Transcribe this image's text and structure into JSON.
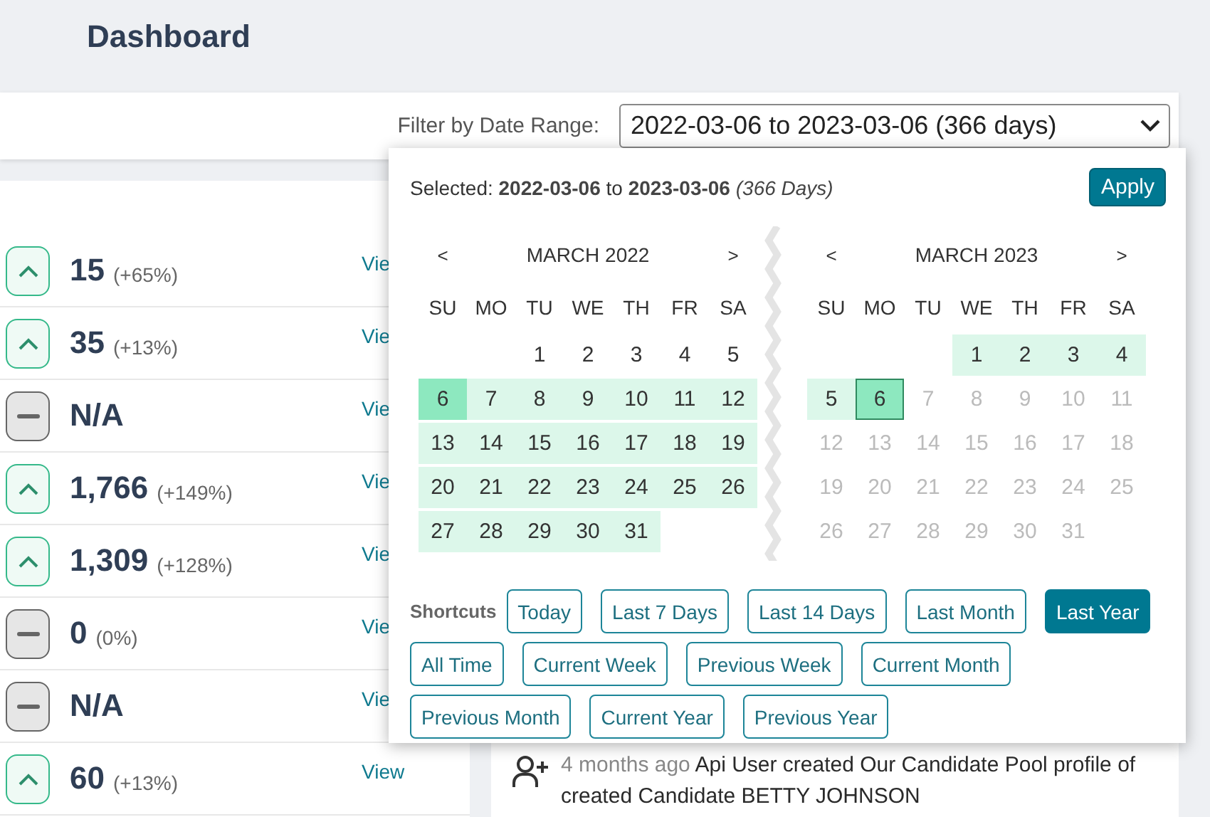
{
  "page": {
    "title": "Dashboard"
  },
  "filter": {
    "label": "Filter by Date Range:",
    "value": "2022-03-06 to 2023-03-06 (366 days)"
  },
  "stats": [
    {
      "kind": "up",
      "value": "15",
      "change": "(+65%)",
      "link": "Vie"
    },
    {
      "kind": "up",
      "value": "35",
      "change": "(+13%)",
      "link": "Vie"
    },
    {
      "kind": "flat",
      "value": "N/A",
      "link": "Vie"
    },
    {
      "kind": "up",
      "value": "1,766",
      "change": "(+149%)",
      "link": "Vie"
    },
    {
      "kind": "up",
      "value": "1,309",
      "change": "(+128%)",
      "link": "Vie"
    },
    {
      "kind": "flat",
      "value": "0",
      "change": "(0%)",
      "link": "Vie"
    },
    {
      "kind": "flat",
      "value": "N/A",
      "link": "Vie"
    },
    {
      "kind": "up",
      "value": "60",
      "change": "(+13%)",
      "link": "View"
    }
  ],
  "activity": {
    "time": "4 months ago",
    "text": "Api User created Our Candidate Pool profile of created Candidate BETTY JOHNSON"
  },
  "picker": {
    "summary": "Selected: **2022-03-06** to **2023-03-06** *(366 Days)*",
    "apply": "Apply",
    "months": [
      {
        "title": "MARCH 2022",
        "prev": "<",
        "next": ">",
        "weekdays": [
          "SU",
          "MO",
          "TU",
          "WE",
          "TH",
          "FR",
          "SA"
        ],
        "weeks": [
          [
            {
              "kind": "blank"
            },
            {
              "kind": "blank"
            },
            {
              "kind": "day",
              "day": "1",
              "in_range": false,
              "endpoint": false,
              "focused": false,
              "disabled": false
            },
            {
              "kind": "day",
              "day": "2",
              "in_range": false,
              "endpoint": false,
              "focused": false,
              "disabled": false
            },
            {
              "kind": "day",
              "day": "3",
              "in_range": false,
              "endpoint": false,
              "focused": false,
              "disabled": false
            },
            {
              "kind": "day",
              "day": "4",
              "in_range": false,
              "endpoint": false,
              "focused": false,
              "disabled": false
            },
            {
              "kind": "day",
              "day": "5",
              "in_range": false,
              "endpoint": false,
              "focused": false,
              "disabled": false
            }
          ],
          [
            {
              "kind": "day",
              "day": "6",
              "in_range": true,
              "endpoint": true,
              "focused": false,
              "disabled": false
            },
            {
              "kind": "day",
              "day": "7",
              "in_range": true,
              "endpoint": false,
              "focused": false,
              "disabled": false
            },
            {
              "kind": "day",
              "day": "8",
              "in_range": true,
              "endpoint": false,
              "focused": false,
              "disabled": false
            },
            {
              "kind": "day",
              "day": "9",
              "in_range": true,
              "endpoint": false,
              "focused": false,
              "disabled": false
            },
            {
              "kind": "day",
              "day": "10",
              "in_range": true,
              "endpoint": false,
              "focused": false,
              "disabled": false
            },
            {
              "kind": "day",
              "day": "11",
              "in_range": true,
              "endpoint": false,
              "focused": false,
              "disabled": false
            },
            {
              "kind": "day",
              "day": "12",
              "in_range": true,
              "endpoint": false,
              "focused": false,
              "disabled": false
            }
          ],
          [
            {
              "kind": "day",
              "day": "13",
              "in_range": true,
              "endpoint": false,
              "focused": false,
              "disabled": false
            },
            {
              "kind": "day",
              "day": "14",
              "in_range": true,
              "endpoint": false,
              "focused": false,
              "disabled": false
            },
            {
              "kind": "day",
              "day": "15",
              "in_range": true,
              "endpoint": false,
              "focused": false,
              "disabled": false
            },
            {
              "kind": "day",
              "day": "16",
              "in_range": true,
              "endpoint": false,
              "focused": false,
              "disabled": false
            },
            {
              "kind": "day",
              "day": "17",
              "in_range": true,
              "endpoint": false,
              "focused": false,
              "disabled": false
            },
            {
              "kind": "day",
              "day": "18",
              "in_range": true,
              "endpoint": false,
              "focused": false,
              "disabled": false
            },
            {
              "kind": "day",
              "day": "19",
              "in_range": true,
              "endpoint": false,
              "focused": false,
              "disabled": false
            }
          ],
          [
            {
              "kind": "day",
              "day": "20",
              "in_range": true,
              "endpoint": false,
              "focused": false,
              "disabled": false
            },
            {
              "kind": "day",
              "day": "21",
              "in_range": true,
              "endpoint": false,
              "focused": false,
              "disabled": false
            },
            {
              "kind": "day",
              "day": "22",
              "in_range": true,
              "endpoint": false,
              "focused": false,
              "disabled": false
            },
            {
              "kind": "day",
              "day": "23",
              "in_range": true,
              "endpoint": false,
              "focused": false,
              "disabled": false
            },
            {
              "kind": "day",
              "day": "24",
              "in_range": true,
              "endpoint": false,
              "focused": false,
              "disabled": false
            },
            {
              "kind": "day",
              "day": "25",
              "in_range": true,
              "endpoint": false,
              "focused": false,
              "disabled": false
            },
            {
              "kind": "day",
              "day": "26",
              "in_range": true,
              "endpoint": false,
              "focused": false,
              "disabled": false
            }
          ],
          [
            {
              "kind": "day",
              "day": "27",
              "in_range": true,
              "endpoint": false,
              "focused": false,
              "disabled": false
            },
            {
              "kind": "day",
              "day": "28",
              "in_range": true,
              "endpoint": false,
              "focused": false,
              "disabled": false
            },
            {
              "kind": "day",
              "day": "29",
              "in_range": true,
              "endpoint": false,
              "focused": false,
              "disabled": false
            },
            {
              "kind": "day",
              "day": "30",
              "in_range": true,
              "endpoint": false,
              "focused": false,
              "disabled": false
            },
            {
              "kind": "day",
              "day": "31",
              "in_range": true,
              "endpoint": false,
              "focused": false,
              "disabled": false
            }
          ]
        ]
      },
      {
        "title": "MARCH 2023",
        "prev": "<",
        "next": ">",
        "weekdays": [
          "SU",
          "MO",
          "TU",
          "WE",
          "TH",
          "FR",
          "SA"
        ],
        "weeks": [
          [
            {
              "kind": "blank"
            },
            {
              "kind": "blank"
            },
            {
              "kind": "blank"
            },
            {
              "kind": "day",
              "day": "1",
              "in_range": true,
              "endpoint": false,
              "focused": false,
              "disabled": false
            },
            {
              "kind": "day",
              "day": "2",
              "in_range": true,
              "endpoint": false,
              "focused": false,
              "disabled": false
            },
            {
              "kind": "day",
              "day": "3",
              "in_range": true,
              "endpoint": false,
              "focused": false,
              "disabled": false
            },
            {
              "kind": "day",
              "day": "4",
              "in_range": true,
              "endpoint": false,
              "focused": false,
              "disabled": false
            }
          ],
          [
            {
              "kind": "day",
              "day": "5",
              "in_range": true,
              "endpoint": false,
              "focused": false,
              "disabled": false
            },
            {
              "kind": "day",
              "day": "6",
              "in_range": true,
              "endpoint": true,
              "focused": true,
              "disabled": false
            },
            {
              "kind": "day",
              "day": "7",
              "in_range": false,
              "endpoint": false,
              "focused": false,
              "disabled": true
            },
            {
              "kind": "day",
              "day": "8",
              "in_range": false,
              "endpoint": false,
              "focused": false,
              "disabled": true
            },
            {
              "kind": "day",
              "day": "9",
              "in_range": false,
              "endpoint": false,
              "focused": false,
              "disabled": true
            },
            {
              "kind": "day",
              "day": "10",
              "in_range": false,
              "endpoint": false,
              "focused": false,
              "disabled": true
            },
            {
              "kind": "day",
              "day": "11",
              "in_range": false,
              "endpoint": false,
              "focused": false,
              "disabled": true
            }
          ],
          [
            {
              "kind": "day",
              "day": "12",
              "in_range": false,
              "endpoint": false,
              "focused": false,
              "disabled": true
            },
            {
              "kind": "day",
              "day": "13",
              "in_range": false,
              "endpoint": false,
              "focused": false,
              "disabled": true
            },
            {
              "kind": "day",
              "day": "14",
              "in_range": false,
              "endpoint": false,
              "focused": false,
              "disabled": true
            },
            {
              "kind": "day",
              "day": "15",
              "in_range": false,
              "endpoint": false,
              "focused": false,
              "disabled": true
            },
            {
              "kind": "day",
              "day": "16",
              "in_range": false,
              "endpoint": false,
              "focused": false,
              "disabled": true
            },
            {
              "kind": "day",
              "day": "17",
              "in_range": false,
              "endpoint": false,
              "focused": false,
              "disabled": true
            },
            {
              "kind": "day",
              "day": "18",
              "in_range": false,
              "endpoint": false,
              "focused": false,
              "disabled": true
            }
          ],
          [
            {
              "kind": "day",
              "day": "19",
              "in_range": false,
              "endpoint": false,
              "focused": false,
              "disabled": true
            },
            {
              "kind": "day",
              "day": "20",
              "in_range": false,
              "endpoint": false,
              "focused": false,
              "disabled": true
            },
            {
              "kind": "day",
              "day": "21",
              "in_range": false,
              "endpoint": false,
              "focused": false,
              "disabled": true
            },
            {
              "kind": "day",
              "day": "22",
              "in_range": false,
              "endpoint": false,
              "focused": false,
              "disabled": true
            },
            {
              "kind": "day",
              "day": "23",
              "in_range": false,
              "endpoint": false,
              "focused": false,
              "disabled": true
            },
            {
              "kind": "day",
              "day": "24",
              "in_range": false,
              "endpoint": false,
              "focused": false,
              "disabled": true
            },
            {
              "kind": "day",
              "day": "25",
              "in_range": false,
              "endpoint": false,
              "focused": false,
              "disabled": true
            }
          ],
          [
            {
              "kind": "day",
              "day": "26",
              "in_range": false,
              "endpoint": false,
              "focused": false,
              "disabled": true
            },
            {
              "kind": "day",
              "day": "27",
              "in_range": false,
              "endpoint": false,
              "focused": false,
              "disabled": true
            },
            {
              "kind": "day",
              "day": "28",
              "in_range": false,
              "endpoint": false,
              "focused": false,
              "disabled": true
            },
            {
              "kind": "day",
              "day": "29",
              "in_range": false,
              "endpoint": false,
              "focused": false,
              "disabled": true
            },
            {
              "kind": "day",
              "day": "30",
              "in_range": false,
              "endpoint": false,
              "focused": false,
              "disabled": true
            },
            {
              "kind": "day",
              "day": "31",
              "in_range": false,
              "endpoint": false,
              "focused": false,
              "disabled": true
            }
          ]
        ]
      }
    ],
    "shortcuts_label": "Shortcuts",
    "shortcuts": [
      [
        {
          "label": "Today",
          "selected": false
        },
        {
          "label": "Last 7 Days",
          "selected": false
        },
        {
          "label": "Last 14 Days",
          "selected": false
        },
        {
          "label": "Last Month",
          "selected": false
        },
        {
          "label": "Last Year",
          "selected": true
        }
      ],
      [
        {
          "label": "All Time",
          "selected": false
        },
        {
          "label": "Current Week",
          "selected": false
        },
        {
          "label": "Previous Week",
          "selected": false
        },
        {
          "label": "Current Month",
          "selected": false
        }
      ],
      [
        {
          "label": "Previous Month",
          "selected": false
        },
        {
          "label": "Current Year",
          "selected": false
        },
        {
          "label": "Previous Year",
          "selected": false
        }
      ]
    ]
  }
}
